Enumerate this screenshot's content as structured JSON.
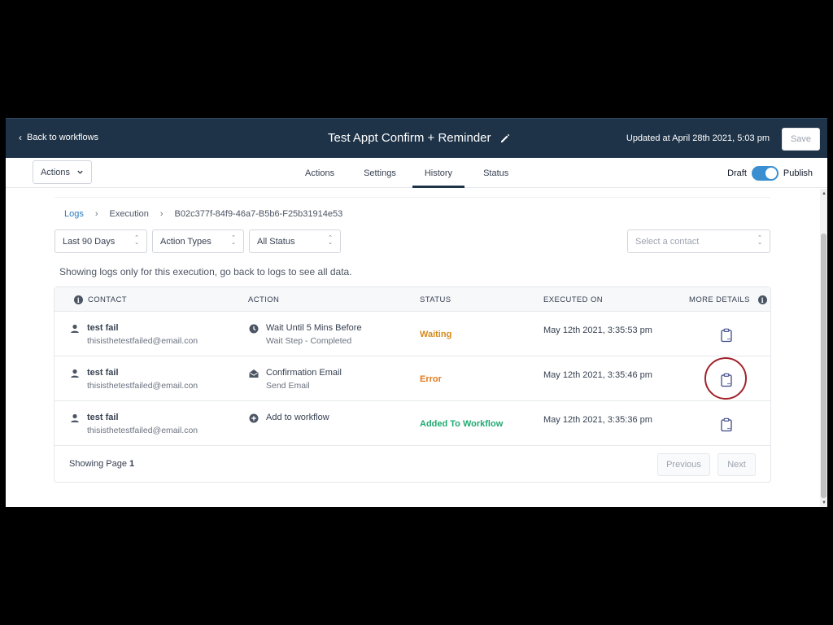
{
  "header": {
    "back_label": "Back to workflows",
    "title": "Test Appt Confirm + Reminder",
    "updated": "Updated at April 28th 2021, 5:03 pm",
    "save_label": "Save"
  },
  "subnav": {
    "actions_label": "Actions",
    "tabs": [
      {
        "label": "Actions"
      },
      {
        "label": "Settings"
      },
      {
        "label": "History"
      },
      {
        "label": "Status"
      }
    ],
    "active_tab": "History",
    "draft_label": "Draft",
    "publish_label": "Publish"
  },
  "breadcrumb": {
    "logs": "Logs",
    "execution": "Execution",
    "execution_id": "B02c377f-84f9-46a7-B5b6-F25b31914e53"
  },
  "filters": {
    "date_range": "Last 90 Days",
    "action_types": "Action Types",
    "status": "All Status",
    "contact_placeholder": "Select a contact"
  },
  "notice": "Showing logs only for this execution, go back to logs to see all data.",
  "table": {
    "headers": {
      "contact": "CONTACT",
      "action": "ACTION",
      "status": "STATUS",
      "executed_on": "EXECUTED ON",
      "more_details": "MORE DETAILS"
    },
    "rows": [
      {
        "contact_name": "test fail",
        "contact_email": "thisisthetestfailed@email.con",
        "action_icon": "clock-icon",
        "action_title": "Wait Until 5 Mins Before",
        "action_sub": "Wait Step - Completed",
        "status": "Waiting",
        "status_color": "#d68a1a",
        "executed_on": "May 12th 2021, 3:35:53 pm"
      },
      {
        "contact_name": "test fail",
        "contact_email": "thisisthetestfailed@email.con",
        "action_icon": "envelope-open-icon",
        "action_title": "Confirmation Email",
        "action_sub": "Send Email",
        "status": "Error",
        "status_color": "#e07b1f",
        "executed_on": "May 12th 2021, 3:35:46 pm"
      },
      {
        "contact_name": "test fail",
        "contact_email": "thisisthetestfailed@email.con",
        "action_icon": "plus-circle-icon",
        "action_title": "Add to workflow",
        "action_sub": "",
        "status": "Added To Workflow",
        "status_color": "#1fa971",
        "executed_on": "May 12th 2021, 3:35:36 pm"
      }
    ],
    "footer": {
      "showing_page_label": "Showing Page",
      "page_number": "1",
      "previous_label": "Previous",
      "next_label": "Next"
    }
  },
  "colors": {
    "header_bg": "#1e3348",
    "accent_blue": "#3b8fd1",
    "link_blue": "#2b7cc0",
    "details_icon": "#3f4a8a",
    "highlight_ring": "#a0222b"
  }
}
